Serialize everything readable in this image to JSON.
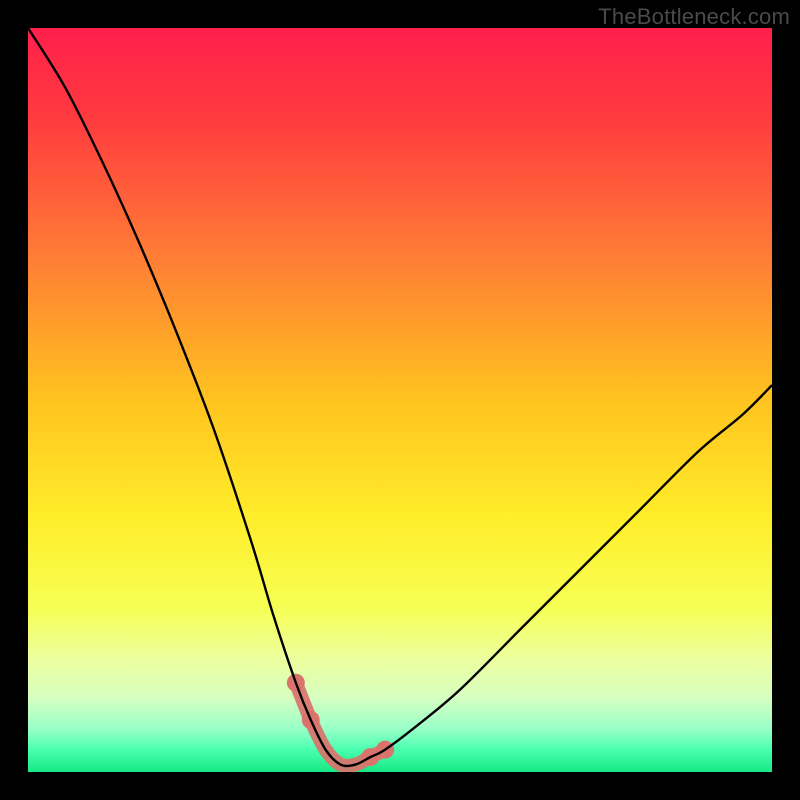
{
  "watermark": "TheBottleneck.com",
  "chart_data": {
    "type": "line",
    "title": "",
    "xlabel": "",
    "ylabel": "",
    "xlim": [
      0,
      100
    ],
    "ylim": [
      0,
      100
    ],
    "grid": false,
    "legend": false,
    "description": "Bottleneck percentage curve. V-shaped curve drawn over a vertical rainbow gradient (red top → green bottom). Minimum near x≈42 where bottleneck approaches 0%. Pink/coral region highlights the bottom of the valley.",
    "gradient_stops": [
      {
        "offset": 0.0,
        "color": "#ff1f4b"
      },
      {
        "offset": 0.12,
        "color": "#ff3a3f"
      },
      {
        "offset": 0.3,
        "color": "#ff7a36"
      },
      {
        "offset": 0.5,
        "color": "#ffc31f"
      },
      {
        "offset": 0.66,
        "color": "#ffee2a"
      },
      {
        "offset": 0.78,
        "color": "#f6ff55"
      },
      {
        "offset": 0.85,
        "color": "#ecffa0"
      },
      {
        "offset": 0.9,
        "color": "#d6ffc0"
      },
      {
        "offset": 0.94,
        "color": "#9dffc8"
      },
      {
        "offset": 0.97,
        "color": "#4affb0"
      },
      {
        "offset": 1.0,
        "color": "#17e884"
      }
    ],
    "series": [
      {
        "name": "bottleneck-curve",
        "x": [
          0,
          5,
          10,
          15,
          20,
          25,
          30,
          33,
          36,
          38,
          40,
          42,
          44,
          46,
          48,
          52,
          58,
          66,
          74,
          82,
          90,
          96,
          100
        ],
        "y": [
          100,
          92,
          82,
          71,
          59,
          46,
          31,
          21,
          12,
          7,
          3,
          1,
          1,
          2,
          3,
          6,
          11,
          19,
          27,
          35,
          43,
          48,
          52
        ]
      }
    ],
    "valley_highlight": {
      "color": "#d9736b",
      "x_range": [
        36,
        49
      ],
      "note": "coral thick stroke along curve bottom with a few round dots"
    }
  }
}
